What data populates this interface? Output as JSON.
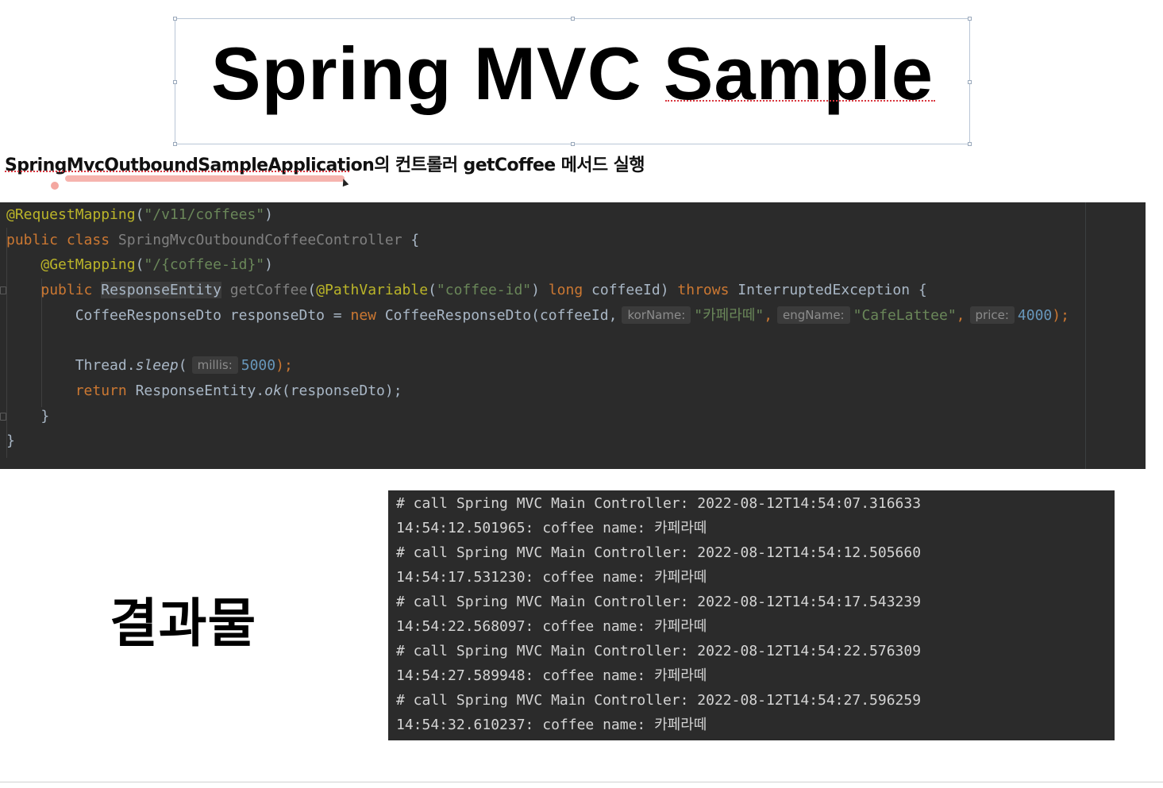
{
  "slide": {
    "title": "Spring MVC Sample",
    "subtitle": "SpringMvcOutboundSampleApplication의 컨트롤러 getCoffee 메서드 실행",
    "result_label": "결과물"
  },
  "code": {
    "line1": {
      "annotation": "@RequestMapping",
      "paren_open": "(",
      "string": "\"/v11/coffees\"",
      "paren_close": ")"
    },
    "line2": {
      "kw1": "public",
      "kw2": "class",
      "class_name": "SpringMvcOutboundCoffeeController",
      "brace": "{"
    },
    "line3": {
      "annotation": "@GetMapping",
      "paren_open": "(",
      "string": "\"/{coffee-id}\"",
      "paren_close": ")"
    },
    "line4": {
      "kw_public": "public",
      "type": "ResponseEntity",
      "method": "getCoffee",
      "paren_open": "(",
      "annotation": "@PathVariable",
      "ann_open": "(",
      "ann_string": "\"coffee-id\"",
      "ann_close": ")",
      "kw_long": "long",
      "param": "coffeeId)",
      "kw_throws": "throws",
      "exception": "InterruptedException",
      "brace": "{"
    },
    "line5": {
      "decl": "CoffeeResponseDto responseDto = ",
      "kw_new": "new",
      "ctor": "CoffeeResponseDto(coffeeId,",
      "hint_kor": "korName:",
      "str_kor": "\"카페라떼\"",
      "comma1": ",",
      "hint_eng": "engName:",
      "str_eng": "\"CafeLattee\"",
      "comma2": ",",
      "hint_price": "price:",
      "num_price": "4000",
      "end": ");"
    },
    "line7": {
      "obj": "Thread.",
      "method": "sleep",
      "paren_open": "(",
      "hint_millis": "millis:",
      "num": "5000",
      "end": ");"
    },
    "line8": {
      "kw_return": "return",
      "obj": "ResponseEntity.",
      "method": "ok",
      "args": "(responseDto);"
    },
    "line9": {
      "brace": "}"
    },
    "line10": {
      "brace": "}"
    }
  },
  "console": {
    "lines": [
      "# call Spring MVC Main Controller: 2022-08-12T14:54:07.316633",
      "14:54:12.501965: coffee name: 카페라떼",
      "# call Spring MVC Main Controller: 2022-08-12T14:54:12.505660",
      "14:54:17.531230: coffee name: 카페라떼",
      "# call Spring MVC Main Controller: 2022-08-12T14:54:17.543239",
      "14:54:22.568097: coffee name: 카페라떼",
      "# call Spring MVC Main Controller: 2022-08-12T14:54:22.576309",
      "14:54:27.589948: coffee name: 카페라떼",
      "# call Spring MVC Main Controller: 2022-08-12T14:54:27.596259",
      "14:54:32.610237: coffee name: 카페라떼"
    ]
  },
  "colors": {
    "editor_bg": "#2b2b2b",
    "keyword": "#cc7832",
    "annotation": "#bbb529",
    "string": "#6a8759",
    "number": "#6897bb",
    "identifier": "#a9b7c6"
  }
}
